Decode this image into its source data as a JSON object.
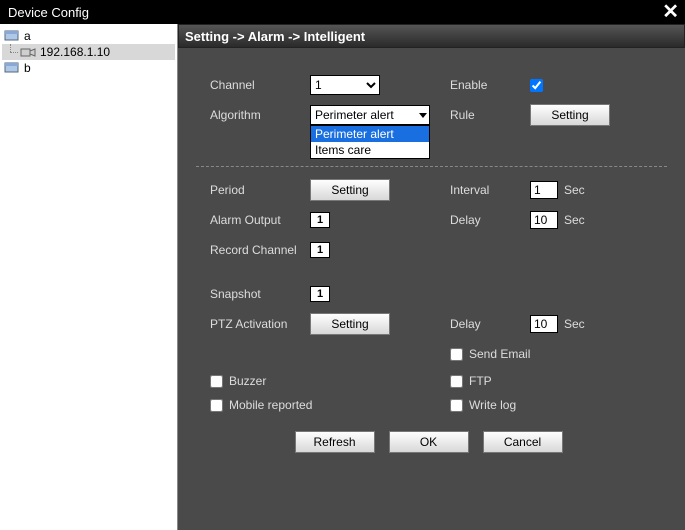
{
  "window": {
    "title": "Device Config"
  },
  "tree": {
    "node_a": "a",
    "node_a_ip": "192.168.1.10",
    "node_b": "b"
  },
  "breadcrumb": "Setting -> Alarm -> Intelligent",
  "labels": {
    "channel": "Channel",
    "enable": "Enable",
    "algorithm": "Algorithm",
    "rule": "Rule",
    "period": "Period",
    "interval": "Interval",
    "alarm_output": "Alarm Output",
    "delay": "Delay",
    "record_channel": "Record Channel",
    "snapshot": "Snapshot",
    "ptz_activation": "PTZ Activation",
    "send_email": "Send Email",
    "buzzer": "Buzzer",
    "ftp": "FTP",
    "mobile_reported": "Mobile reported",
    "write_log": "Write log",
    "sec": "Sec"
  },
  "buttons": {
    "setting": "Setting",
    "refresh": "Refresh",
    "ok": "OK",
    "cancel": "Cancel"
  },
  "values": {
    "channel": "1",
    "algorithm_selected": "Perimeter alert",
    "algorithm_options": [
      "Perimeter alert",
      "Items care"
    ],
    "enable_checked": true,
    "interval": "1",
    "delay_alarm": "10",
    "alarm_output_box": "1",
    "record_channel_box": "1",
    "snapshot_box": "1",
    "ptz_delay": "10",
    "send_email": false,
    "buzzer": false,
    "ftp": false,
    "mobile_reported": false,
    "write_log": false
  }
}
